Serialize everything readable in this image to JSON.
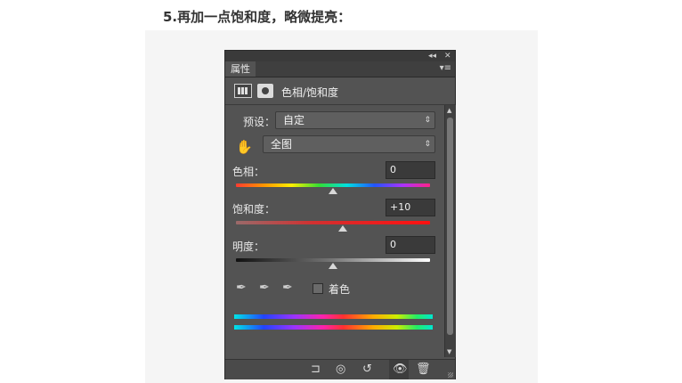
{
  "heading": "5.再加一点饱和度，略微提亮：",
  "panel": {
    "tab_label": "属性",
    "title_buttons": [
      "◂◂",
      "✕"
    ],
    "tab_menu": "▾≡",
    "header_title": "色相/饱和度",
    "preset": {
      "label": "预设：",
      "value": "自定"
    },
    "channel": {
      "value": "全图"
    },
    "hue": {
      "label": "色相：",
      "value": "0",
      "level": 0
    },
    "saturation": {
      "label": "饱和度：",
      "value": "+10",
      "level": 10
    },
    "lightness": {
      "label": "明度：",
      "value": "0",
      "level": 0
    },
    "colorize_label": "着色",
    "colorize_checked": false
  },
  "icons": {
    "hand": "✋",
    "eyedropper": "✒",
    "eyedropper_plus": "✒",
    "eyedropper_minus": "✒",
    "clip": "⊐",
    "view": "◎",
    "reset": "↺",
    "eye": "👁",
    "trash": "🗑"
  },
  "colors": {
    "panel_bg": "#535353",
    "heading": "#333333"
  }
}
